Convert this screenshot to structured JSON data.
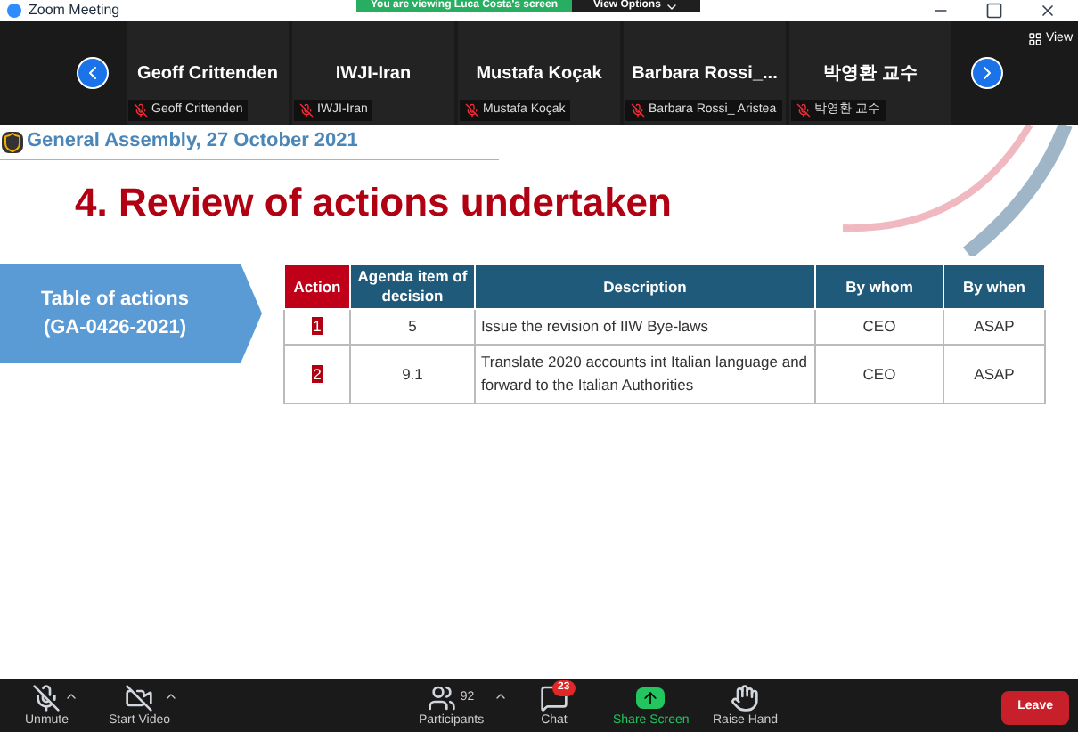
{
  "window": {
    "title": "Zoom Meeting"
  },
  "share_banner": {
    "text": "You are viewing Luca Costa's screen",
    "options": "View Options"
  },
  "view_button": "View",
  "participants": [
    {
      "display": "Geoff Crittenden",
      "label": "Geoff Crittenden",
      "muted": true
    },
    {
      "display": "IWJI-Iran",
      "label": "IWJI-Iran",
      "muted": true
    },
    {
      "display": "Mustafa Koçak",
      "label": "Mustafa Koçak",
      "muted": true
    },
    {
      "display": "Barbara  Rossi_...",
      "label": "Barbara Rossi_ Aristea",
      "muted": true
    },
    {
      "display": "박영환 교수",
      "label": "박영환 교수",
      "muted": true
    }
  ],
  "slide": {
    "header": "General Assembly, 27 October 2021",
    "title": "4. Review of actions undertaken",
    "side_label": [
      "Table of actions",
      "(GA-0426-2021)"
    ],
    "table": {
      "columns": [
        "Action",
        "Agenda item of decision",
        "Description",
        "By whom",
        "By when"
      ],
      "rows": [
        [
          "1",
          "5",
          "Issue the revision of IIW Bye-laws",
          "CEO",
          "ASAP"
        ],
        [
          "2",
          "9.1",
          "Translate 2020 accounts int Italian language and forward to the Italian Authorities",
          "CEO",
          "ASAP"
        ]
      ]
    }
  },
  "toolbar": {
    "items": [
      {
        "kind": "mic",
        "label": "Unmute"
      },
      {
        "kind": "video",
        "label": "Start Video"
      },
      {
        "kind": "participants",
        "label": "Participants",
        "count": "92"
      },
      {
        "kind": "chat",
        "label": "Chat",
        "badge": "23"
      },
      {
        "kind": "share",
        "label": "Share Screen"
      },
      {
        "kind": "hand",
        "label": "Raise Hand"
      }
    ],
    "leave": "Leave"
  }
}
